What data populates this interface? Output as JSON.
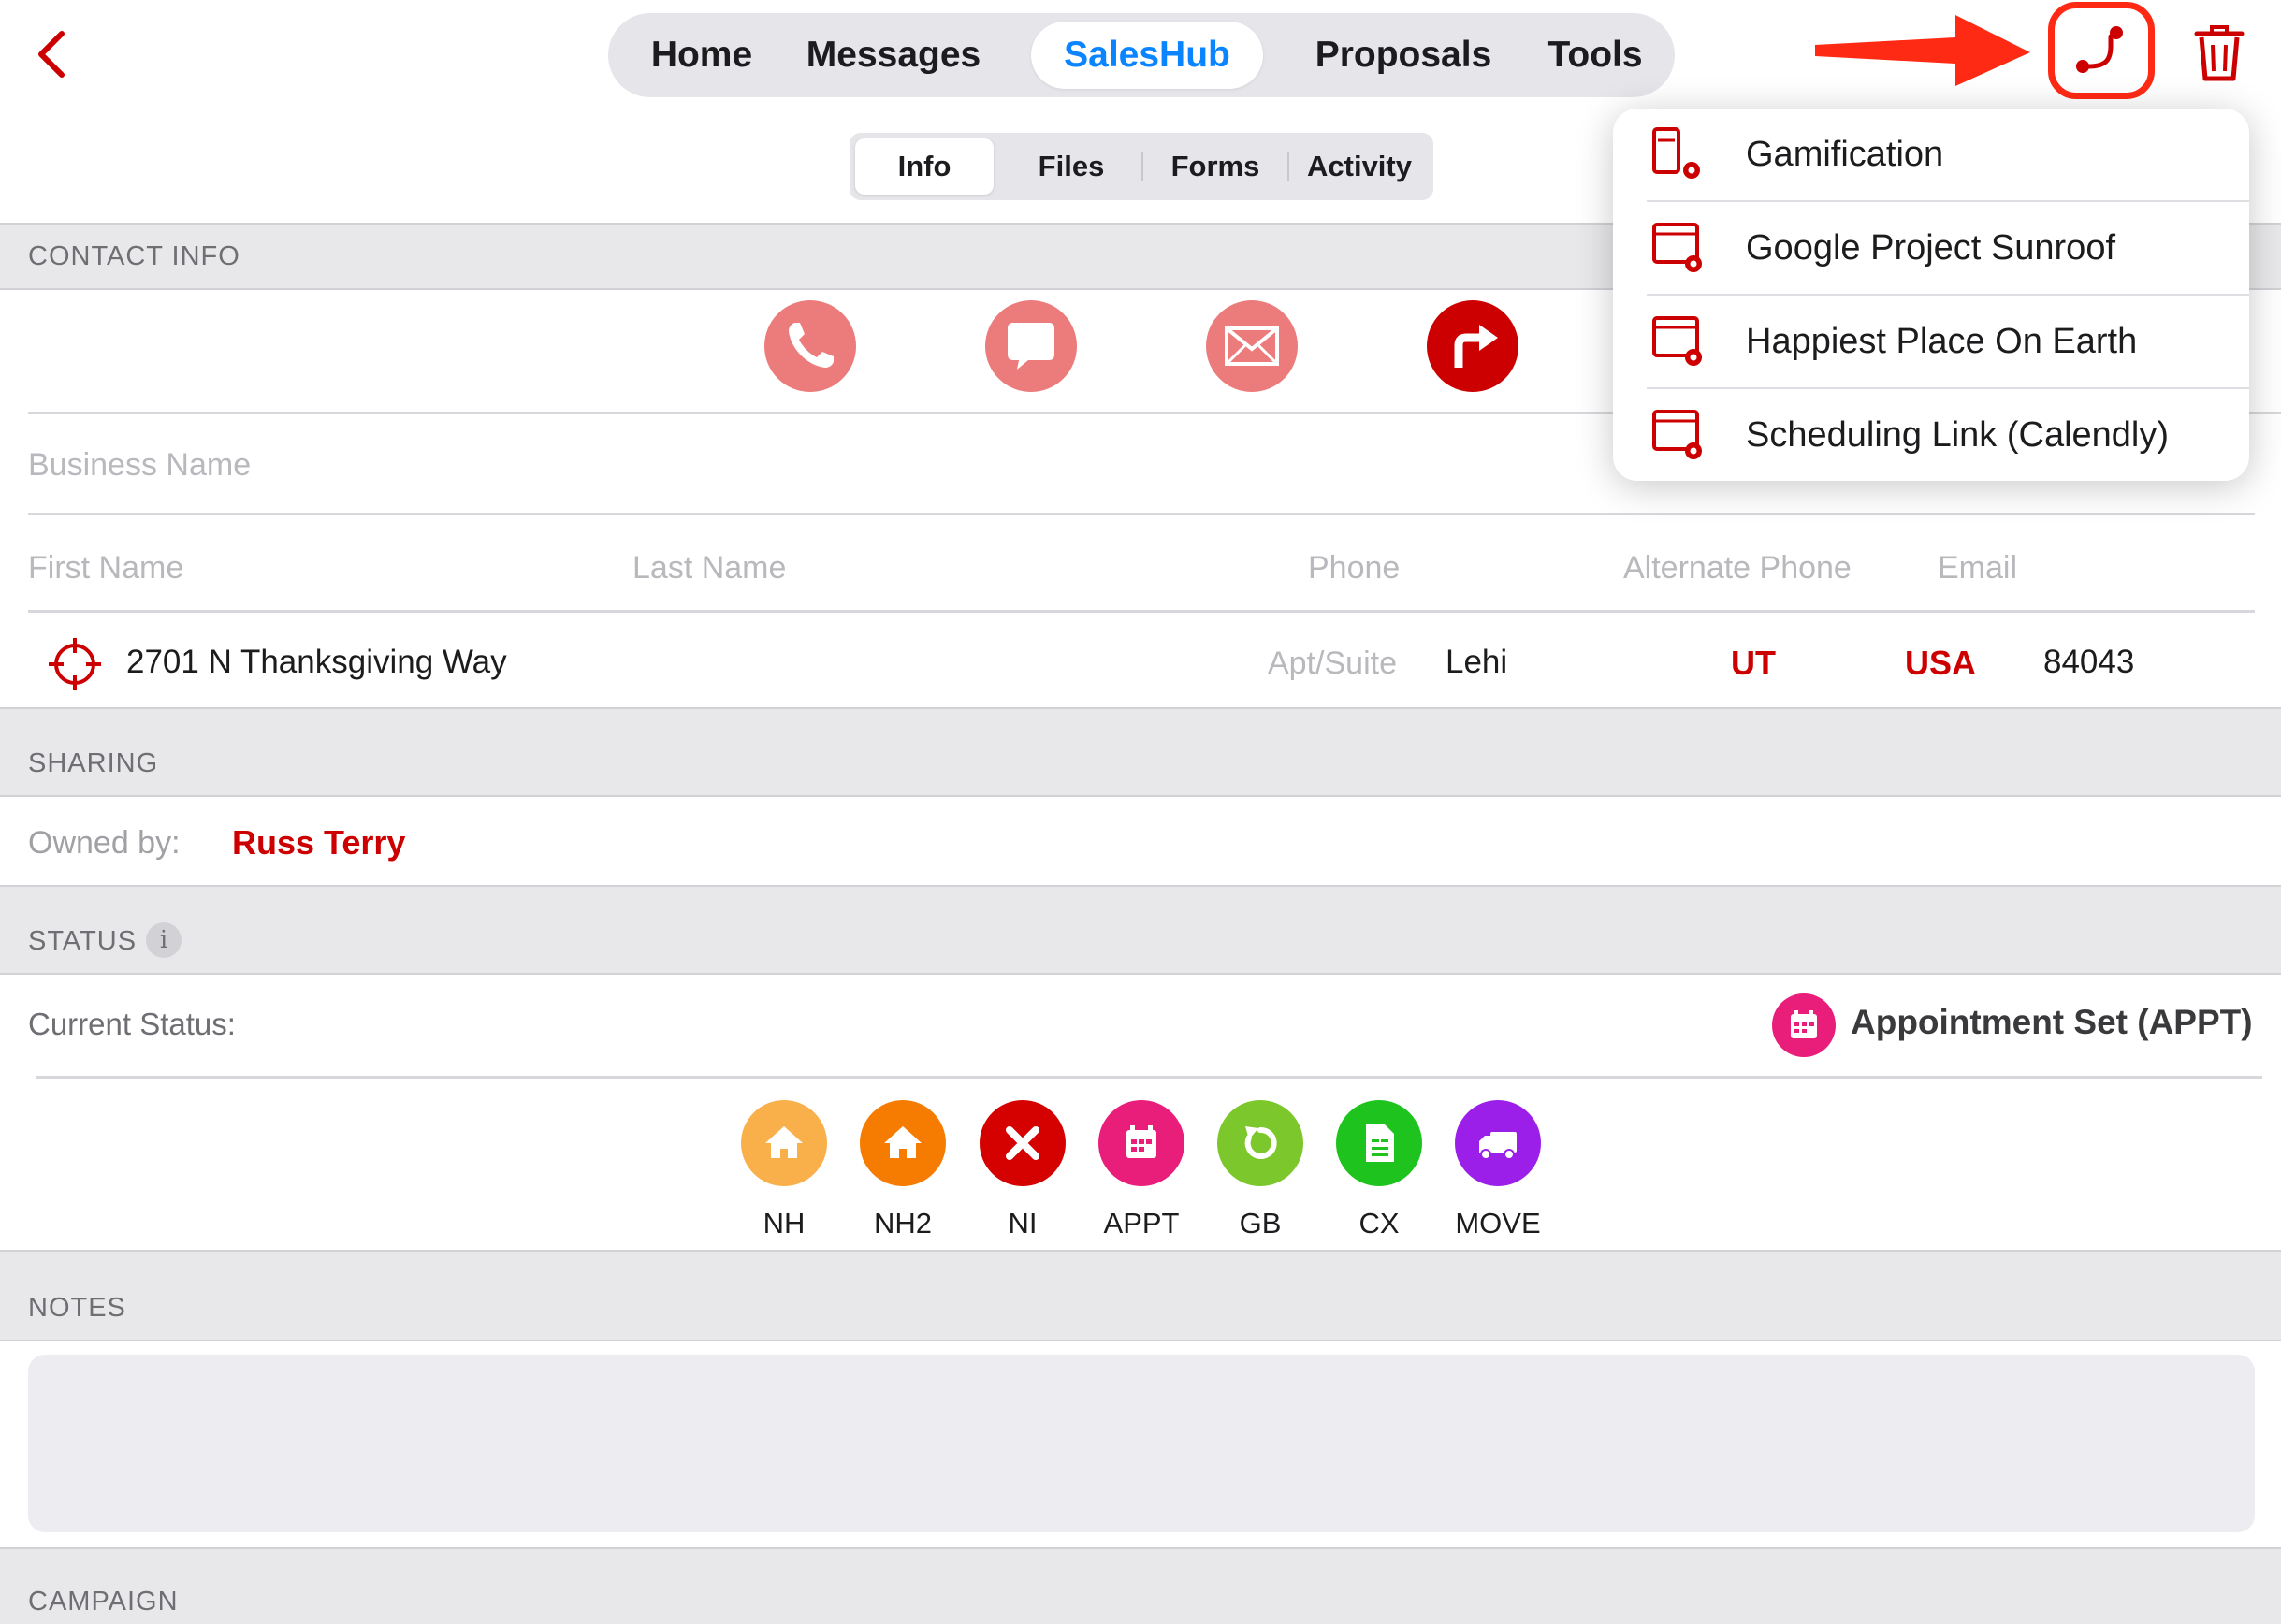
{
  "header": {
    "main_tabs": [
      {
        "label": "Home"
      },
      {
        "label": "Messages"
      },
      {
        "label": "SalesHub"
      },
      {
        "label": "Proposals"
      },
      {
        "label": "Tools"
      }
    ],
    "active_main_tab": "SalesHub",
    "sub_tabs": [
      {
        "label": "Info"
      },
      {
        "label": "Files"
      },
      {
        "label": "Forms"
      },
      {
        "label": "Activity"
      }
    ],
    "active_sub_tab": "Info"
  },
  "menu": {
    "items": [
      {
        "label": "Gamification"
      },
      {
        "label": "Google Project Sunroof"
      },
      {
        "label": "Happiest Place On Earth"
      },
      {
        "label": "Scheduling Link (Calendly)"
      }
    ]
  },
  "contact": {
    "section_title": "CONTACT INFO",
    "business_name_placeholder": "Business Name",
    "first_name_placeholder": "First Name",
    "last_name_placeholder": "Last Name",
    "phone_placeholder": "Phone",
    "alt_phone_placeholder": "Alternate Phone",
    "email_placeholder": "Email",
    "address": {
      "street": "2701 N Thanksgiving Way",
      "apt_placeholder": "Apt/Suite",
      "city": "Lehi",
      "state": "UT",
      "country": "USA",
      "zip": "84043"
    }
  },
  "sharing": {
    "section_title": "SHARING",
    "owned_by_label": "Owned by:",
    "owner": "Russ Terry"
  },
  "status": {
    "section_title": "STATUS",
    "info_glyph": "i",
    "current_label": "Current Status:",
    "current_value": "Appointment Set (APPT)",
    "options": [
      {
        "code": "NH",
        "color": "#f9b04a",
        "icon": "home-icon"
      },
      {
        "code": "NH2",
        "color": "#f57c00",
        "icon": "home-icon"
      },
      {
        "code": "NI",
        "color": "#d50000",
        "icon": "close-icon"
      },
      {
        "code": "APPT",
        "color": "#e91e7b",
        "icon": "calendar-icon"
      },
      {
        "code": "GB",
        "color": "#7cc72b",
        "icon": "refresh-icon"
      },
      {
        "code": "CX",
        "color": "#1ec31e",
        "icon": "document-icon"
      },
      {
        "code": "MOVE",
        "color": "#9b1fe8",
        "icon": "truck-icon"
      }
    ]
  },
  "notes": {
    "section_title": "NOTES"
  },
  "campaign": {
    "section_title": "CAMPAIGN"
  },
  "colors": {
    "accent_red": "#cc0000",
    "link_blue": "#0a84ff",
    "annotation_red": "#ff2a14",
    "contact_pink": "#ec7b7b"
  }
}
